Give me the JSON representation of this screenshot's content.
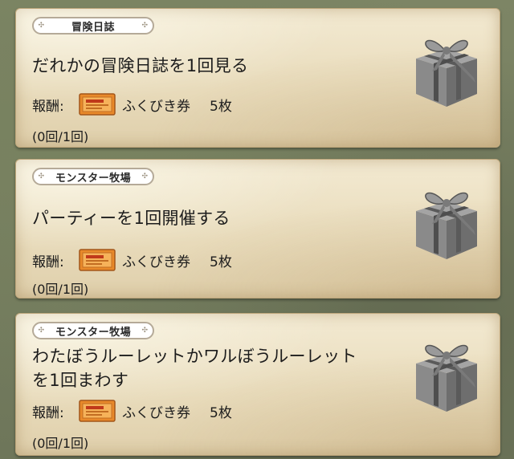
{
  "reward_label": "報酬:",
  "missions": [
    {
      "category": "冒険日誌",
      "title_line1": "だれかの冒険日誌を1回見る",
      "title_line2": "",
      "reward_item": "ふくびき券",
      "reward_qty": "5枚",
      "progress": "(0回/1回)"
    },
    {
      "category": "モンスター牧場",
      "title_line1": "パーティーを1回開催する",
      "title_line2": "",
      "reward_item": "ふくびき券",
      "reward_qty": "5枚",
      "progress": "(0回/1回)"
    },
    {
      "category": "モンスター牧場",
      "title_line1": "わたぼうルーレットかワルぼうルーレット",
      "title_line2": "を1回まわす",
      "reward_item": "ふくびき券",
      "reward_qty": "5枚",
      "progress": "(0回/1回)"
    }
  ],
  "icons": {
    "reward_icon": "lottery-ticket-icon",
    "box_icon": "gift-box-icon",
    "tag_deco": "cross-ornament-icon"
  },
  "colors": {
    "card_bg": "#efe4c8",
    "tag_border": "#b5aa98",
    "ticket": "#e8892a"
  }
}
